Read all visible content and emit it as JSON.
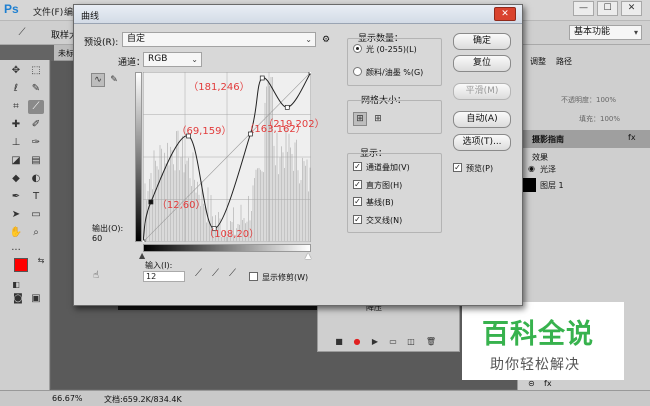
{
  "app": {
    "logo": "Ps",
    "menu": [
      "文件(F)",
      "编"
    ],
    "options_bar": {
      "label": "取样大"
    },
    "tab": {
      "label": "未标"
    },
    "workspace": "基本功能",
    "window_buttons": [
      "—",
      "☐",
      "✕"
    ]
  },
  "panel": {
    "tabs": [
      "调整",
      "路径"
    ],
    "opacity_label": "不透明度：100%",
    "fill_label": "填充：100%",
    "layers": [
      {
        "name": "摄影指南"
      },
      {
        "name": "效果"
      },
      {
        "name": "光泽"
      },
      {
        "name": "图层 1"
      }
    ],
    "bottom_row_label": "降压"
  },
  "status": {
    "zoom": "66.67%",
    "doc": "文档:659.2K/834.4K"
  },
  "dialog": {
    "title": "曲线",
    "preset_label": "预设(R):",
    "preset_value": "自定",
    "channel_label": "通道：",
    "channel_value": "RGB",
    "output_label": "输出(O):",
    "output_value": "60",
    "input_label": "输入(I):",
    "input_value": "12",
    "show_clipping": "显示修剪(W)",
    "display_amount": {
      "title": "显示数量：",
      "options": [
        "光 (0-255)(L)",
        "颜料/油墨 %(G)"
      ],
      "selected": 0
    },
    "grid": {
      "title": "网格大小："
    },
    "show": {
      "title": "显示：",
      "options": [
        "通道叠加(V)",
        "直方图(H)",
        "基线(B)",
        "交叉线(N)"
      ]
    },
    "buttons": {
      "ok": "确定",
      "reset": "复位",
      "smooth": "平滑(M)",
      "auto": "自动(A)",
      "options": "选项(T)..."
    },
    "preview": "预览(P)"
  },
  "chart_data": {
    "type": "line",
    "xlim": [
      0,
      255
    ],
    "ylim": [
      0,
      255
    ],
    "grid": true,
    "points": [
      {
        "x": 12,
        "y": 60,
        "label": "（12,60）"
      },
      {
        "x": 69,
        "y": 159,
        "label": "（69,159）"
      },
      {
        "x": 108,
        "y": 20,
        "label": "（108,20）"
      },
      {
        "x": 163,
        "y": 162,
        "label": "（163,162）"
      },
      {
        "x": 181,
        "y": 246,
        "label": "（181,246）"
      },
      {
        "x": 219,
        "y": 202,
        "label": "（219,202）"
      }
    ],
    "curve_color": "#222222",
    "label_color": "#e23b3b"
  },
  "watermark": {
    "title": "百科全说",
    "subtitle": "助你轻松解决",
    "color": "#37b24d"
  },
  "colors": {
    "foreground": "#ff0000",
    "background": "#ffffff"
  }
}
